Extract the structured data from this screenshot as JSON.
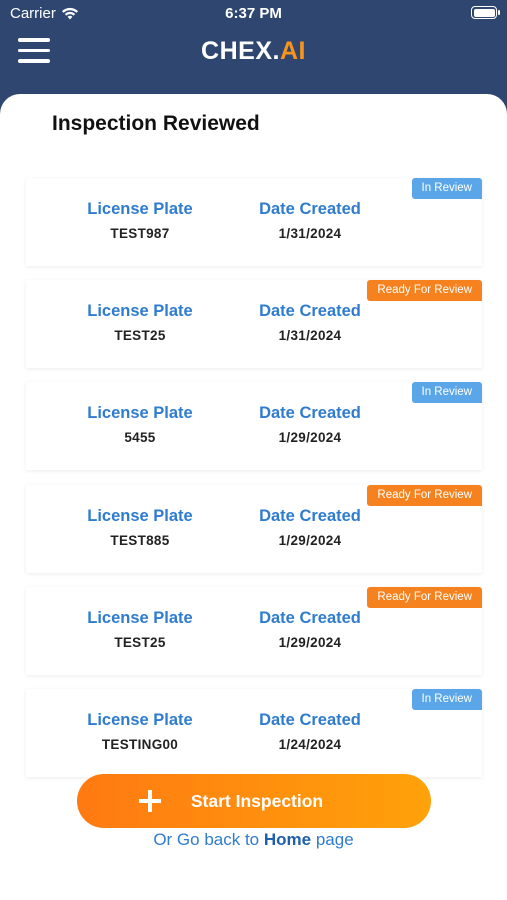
{
  "status_bar": {
    "carrier": "Carrier",
    "time": "6:37 PM"
  },
  "header": {
    "logo_main": "CHEX.",
    "logo_accent": "AI"
  },
  "page": {
    "title": "Inspection Reviewed"
  },
  "labels": {
    "license_plate": "License Plate",
    "date_created": "Date Created"
  },
  "inspections": [
    {
      "status": "In Review",
      "plate": "TEST987",
      "date": "1/31/2024"
    },
    {
      "status": "Ready For Review",
      "plate": "TEST25",
      "date": "1/31/2024"
    },
    {
      "status": "In Review",
      "plate": "5455",
      "date": "1/29/2024"
    },
    {
      "status": "Ready For Review",
      "plate": "TEST885",
      "date": "1/29/2024"
    },
    {
      "status": "Ready For Review",
      "plate": "TEST25",
      "date": "1/29/2024"
    },
    {
      "status": "In Review",
      "plate": "TESTING00",
      "date": "1/24/2024"
    }
  ],
  "actions": {
    "start_inspection": "Start Inspection",
    "back_prefix": "Or Go back to",
    "back_home": "Home",
    "back_suffix": "page"
  },
  "colors": {
    "nav_bg": "#2f4770",
    "accent_orange": "#f6821f",
    "in_review_blue": "#5aa6e8",
    "label_blue": "#2f7ccf"
  }
}
